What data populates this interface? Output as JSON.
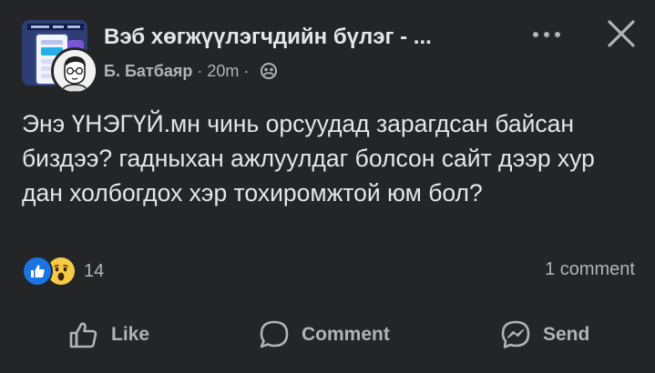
{
  "post": {
    "group_name": "Вэб хөгжүүлэгчдийн бүлэг - ...",
    "author": "Б. Батбаяр",
    "separator": "·",
    "time": "20m",
    "privacy_icon": "group-privacy-icon",
    "text": "Энэ ҮНЭГҮЙ.мн чинь орсуудад зарагдсан байсан биздээ? гадныхан ажлуулдаг болсон сайт дээр хур дан холбогдох хэр тохиромжтой юм бол?"
  },
  "header": {
    "more_icon": "more-icon",
    "close_icon": "close-icon"
  },
  "reactions": {
    "icons": [
      "like-reaction-icon",
      "wow-reaction-icon"
    ],
    "count": "14",
    "comments": "1 comment"
  },
  "actions": {
    "like_label": "Like",
    "comment_label": "Comment",
    "send_label": "Send"
  },
  "colors": {
    "background": "#242526",
    "text_primary": "#e4e6eb",
    "text_secondary": "#b0b3b8",
    "like_blue": "#1b74e4",
    "wow_yellow": "#f7c948"
  }
}
